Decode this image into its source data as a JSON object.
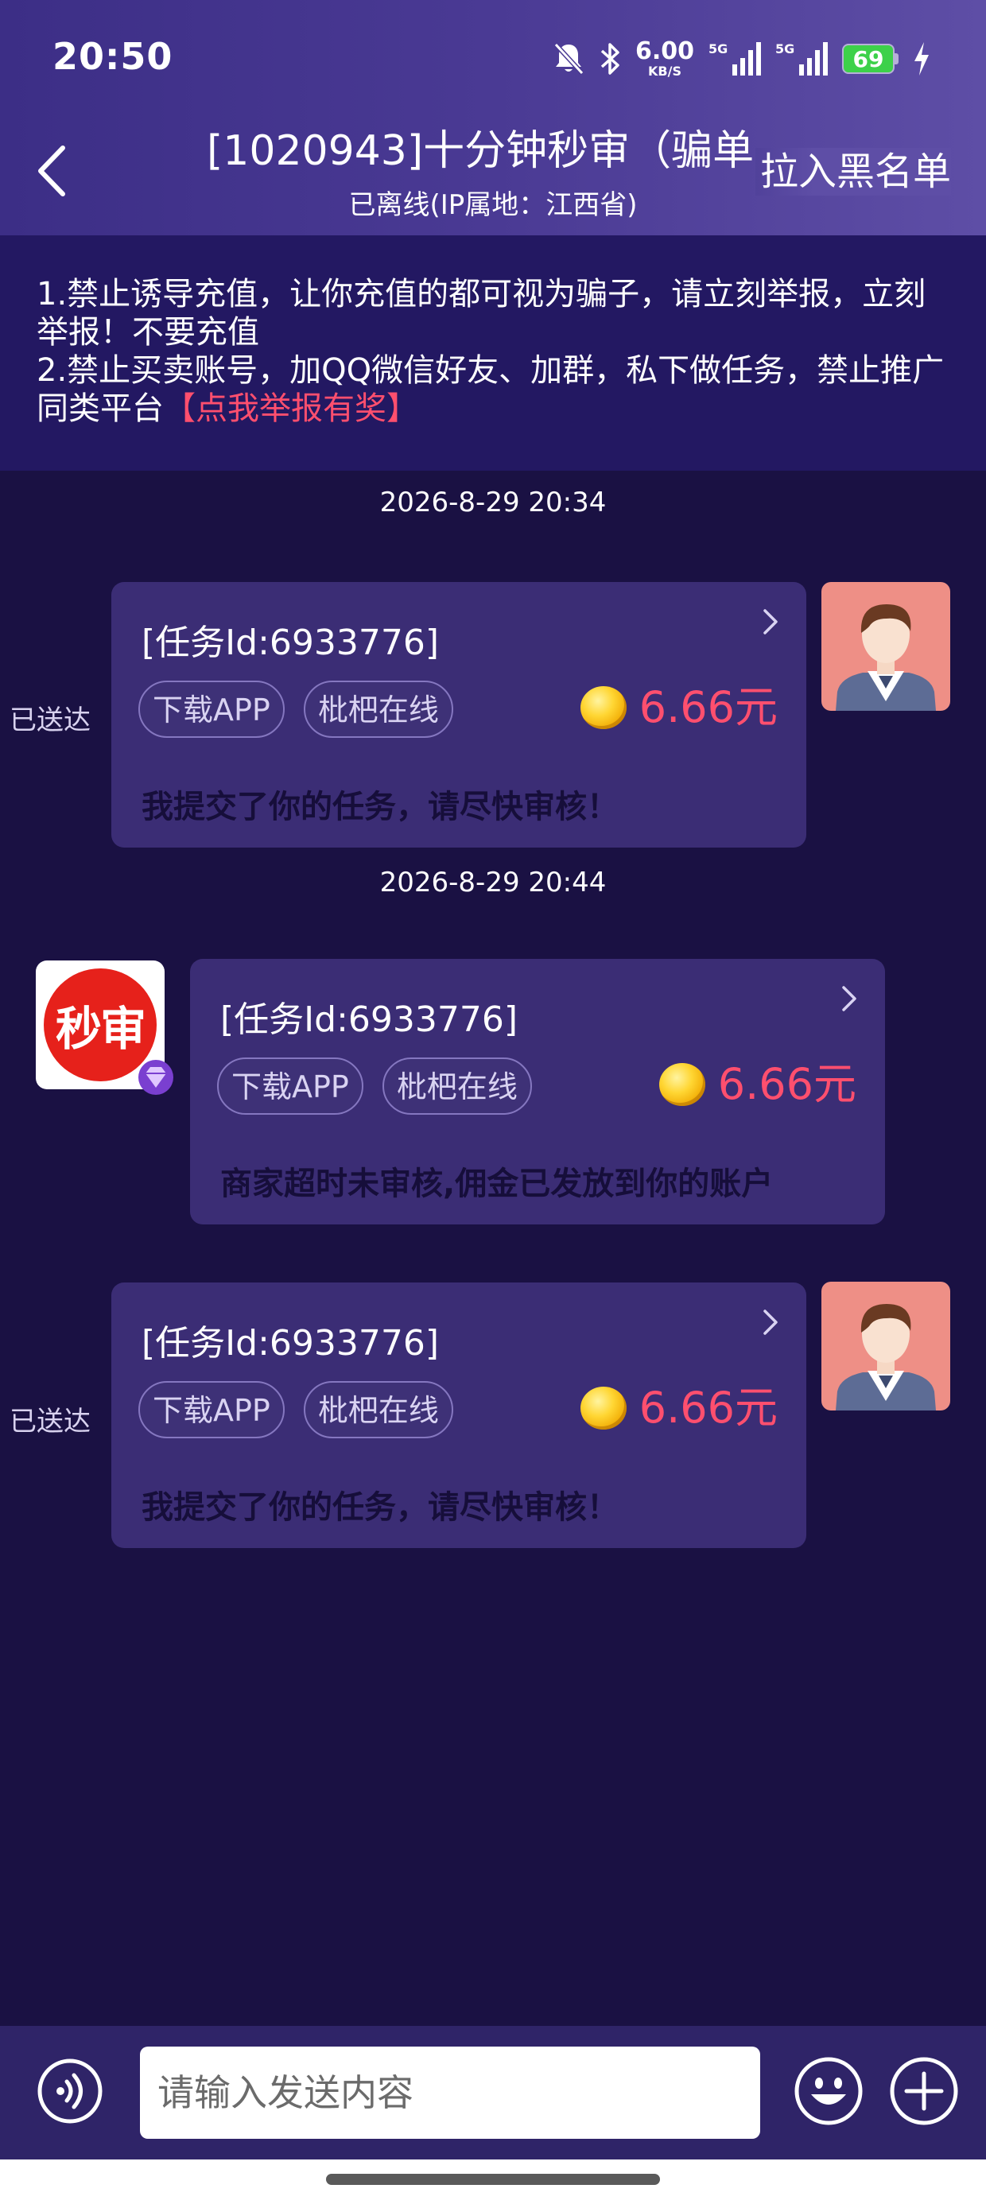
{
  "status_bar": {
    "time": "20:50",
    "net_speed": "6.00",
    "net_speed_unit": "KB/S",
    "network_1": "5G",
    "network_2": "5G",
    "battery": "69"
  },
  "header": {
    "title": "[1020943]十分钟秒审（骗单",
    "subtitle": "已离线(IP属地：江西省)",
    "blacklist_label": "拉入黑名单"
  },
  "notice": {
    "line1": "1.禁止诱导充值，让你充值的都可视为骗子，请立刻举报，立刻举报！不要充值",
    "line2": "2.禁止买卖账号，加QQ微信好友、加群，私下做任务，禁止推广同类平台",
    "report_link": "【点我举报有奖】"
  },
  "messages": [
    {
      "timestamp": "2026-8-29 20:34",
      "status": "已送达",
      "task_id": "[任务Id:6933776]",
      "tags": [
        "下载APP",
        "枇杷在线"
      ],
      "amount": "6.66元",
      "text": "我提交了你的任务，请尽快审核！"
    },
    {
      "timestamp": "2026-8-29 20:44",
      "logo_text": "秒审",
      "task_id": "[任务Id:6933776]",
      "tags": [
        "下载APP",
        "枇杷在线"
      ],
      "amount": "6.66元",
      "text": "商家超时未审核,佣金已发放到你的账户"
    },
    {
      "status": "已送达",
      "task_id": "[任务Id:6933776]",
      "tags": [
        "下载APP",
        "枇杷在线"
      ],
      "amount": "6.66元",
      "text": "我提交了你的任务，请尽快审核！"
    }
  ],
  "input_bar": {
    "placeholder": "请输入发送内容"
  },
  "icons": {
    "back": "chevron-left-icon",
    "voice": "voice-icon",
    "emoji": "emoji-icon",
    "plus": "plus-icon",
    "coin": "coin-icon"
  },
  "colors": {
    "background": "#1a1143",
    "header": "#4a3a94",
    "bubble": "#3b2d75",
    "price": "#ff4f6e",
    "report_link": "#ff4f6e"
  }
}
